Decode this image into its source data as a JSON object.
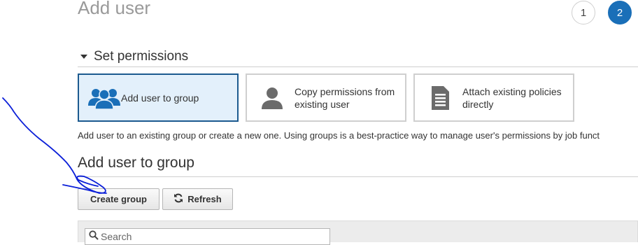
{
  "header": {
    "title": "Add user",
    "steps": [
      "1",
      "2"
    ],
    "active_step": "2"
  },
  "permissions": {
    "section_title": "Set permissions",
    "options": [
      {
        "label": "Add user to group",
        "icon": "group-icon",
        "selected": true
      },
      {
        "label_line1": "Copy permissions from",
        "label_line2": "existing user",
        "icon": "user-icon",
        "selected": false
      },
      {
        "label_line1": "Attach existing policies",
        "label_line2": "directly",
        "icon": "document-icon",
        "selected": false
      }
    ],
    "description": "Add user to an existing group or create a new one. Using groups is a best-practice way to manage user's permissions by job funct"
  },
  "group": {
    "title": "Add user to group",
    "create_label": "Create group",
    "refresh_label": "Refresh",
    "search_placeholder": "Search"
  },
  "colors": {
    "accent": "#1a6fb8",
    "selected_border": "#1c5a8f",
    "selected_bg": "#e3f0fb",
    "annotation_ink": "#0b1fd8"
  }
}
